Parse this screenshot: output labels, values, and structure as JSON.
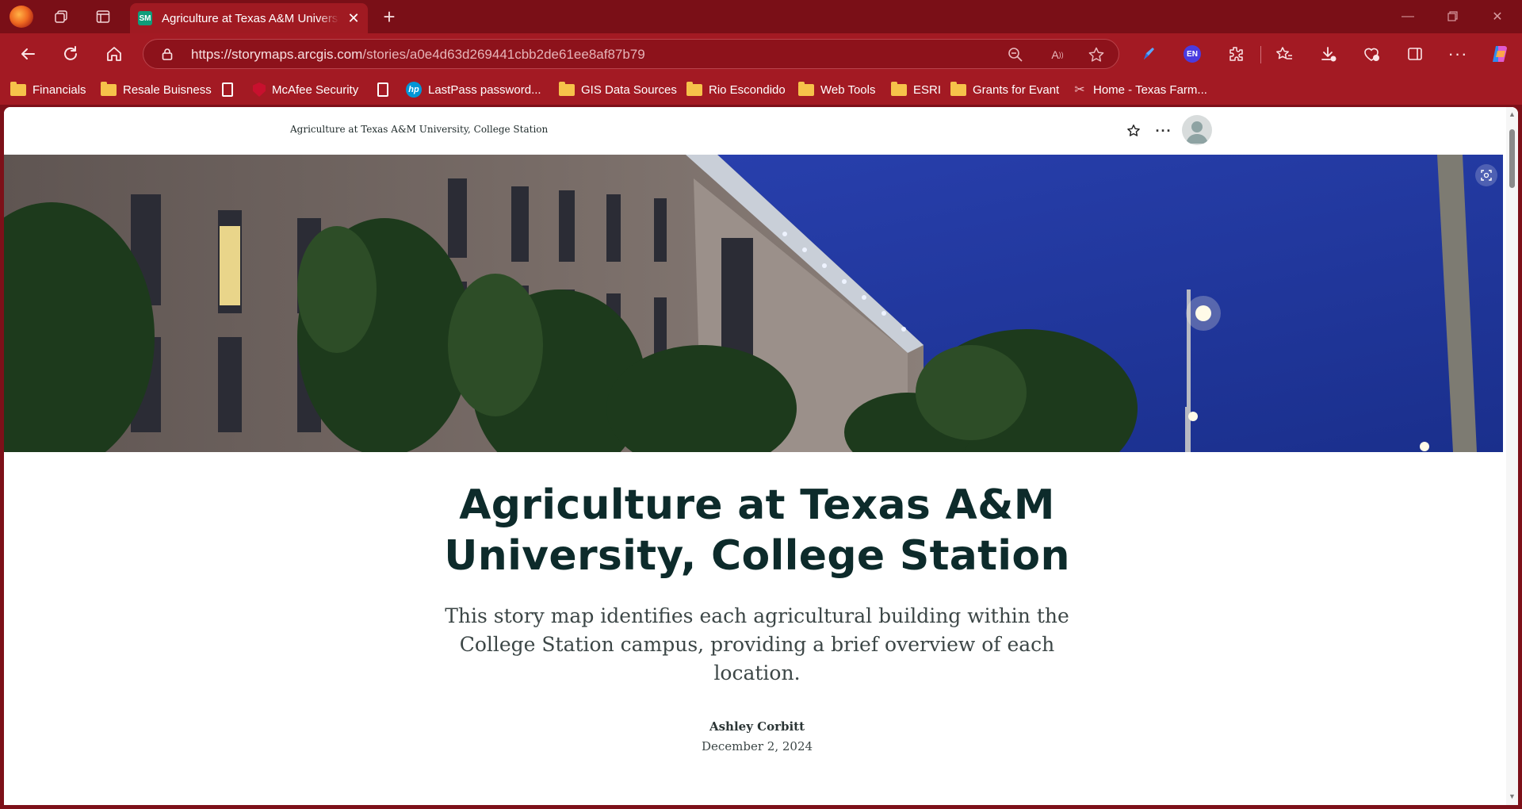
{
  "browser": {
    "tab": {
      "favicon_text": "SM",
      "title": "Agriculture at Texas A&M University, College Station"
    },
    "address": {
      "url_host": "https://storymaps.arcgis.com",
      "url_path": "/stories/a0e4d63d269441cbb2de61ee8af87b79"
    },
    "toolbar": {
      "language_badge": "EN"
    },
    "bookmarks": [
      {
        "label": "Financials",
        "icon": "folder-icon"
      },
      {
        "label": "Resale Buisness",
        "icon": "folder-icon"
      },
      {
        "label": "",
        "icon": "document-icon"
      },
      {
        "label": "McAfee Security",
        "icon": "mcafee-icon"
      },
      {
        "label": "",
        "icon": "document-icon"
      },
      {
        "label": "LastPass password...",
        "icon": "hp-icon"
      },
      {
        "label": "GIS Data Sources",
        "icon": "folder-icon"
      },
      {
        "label": "Rio Escondido",
        "icon": "folder-icon"
      },
      {
        "label": "Web Tools",
        "icon": "folder-icon"
      },
      {
        "label": "ESRI",
        "icon": "folder-icon"
      },
      {
        "label": "Grants for Evant",
        "icon": "folder-icon"
      },
      {
        "label": "Home - Texas Farm...",
        "icon": "texas-farm-icon"
      }
    ],
    "colors": {
      "frame": "#7a0f17",
      "toolbar": "#a31a23"
    }
  },
  "story": {
    "header_title": "Agriculture at Texas A&M University, College Station",
    "title": "Agriculture at Texas A&M University, College Station",
    "subtitle": "This story map identifies each agricultural building within the College Station campus, providing a brief overview of each location.",
    "author": "Ashley Corbitt",
    "date": "December 2, 2024"
  }
}
